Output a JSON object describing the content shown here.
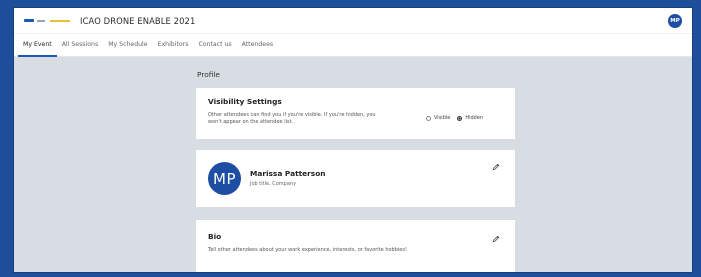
{
  "header": {
    "app_title": "ICAO DRONE ENABLE 2021",
    "user_initials": "MP"
  },
  "tabs": [
    {
      "label": "My Event"
    },
    {
      "label": "All Sessions"
    },
    {
      "label": "My Schedule"
    },
    {
      "label": "Exhibitors"
    },
    {
      "label": "Contact us"
    },
    {
      "label": "Attendees"
    }
  ],
  "profile": {
    "section_title": "Profile",
    "visibility": {
      "title": "Visibility Settings",
      "description": "Other attendees can find you if you're visible. If you're hidden, you won't appear on the attendee list.",
      "options": [
        "Visible",
        "Hidden"
      ],
      "selected": "Hidden"
    },
    "user": {
      "initials": "MP",
      "name": "Marissa Patterson",
      "job": "Job title, Company"
    },
    "bio": {
      "title": "Bio",
      "placeholder": "Tell other attendees about your work experience, interests, or favorite hobbies!"
    }
  },
  "colors": {
    "brand": "#1d4ea3",
    "background": "#d8dde3"
  },
  "icons": {
    "edit": "pencil-icon",
    "logo": "event-logo"
  }
}
